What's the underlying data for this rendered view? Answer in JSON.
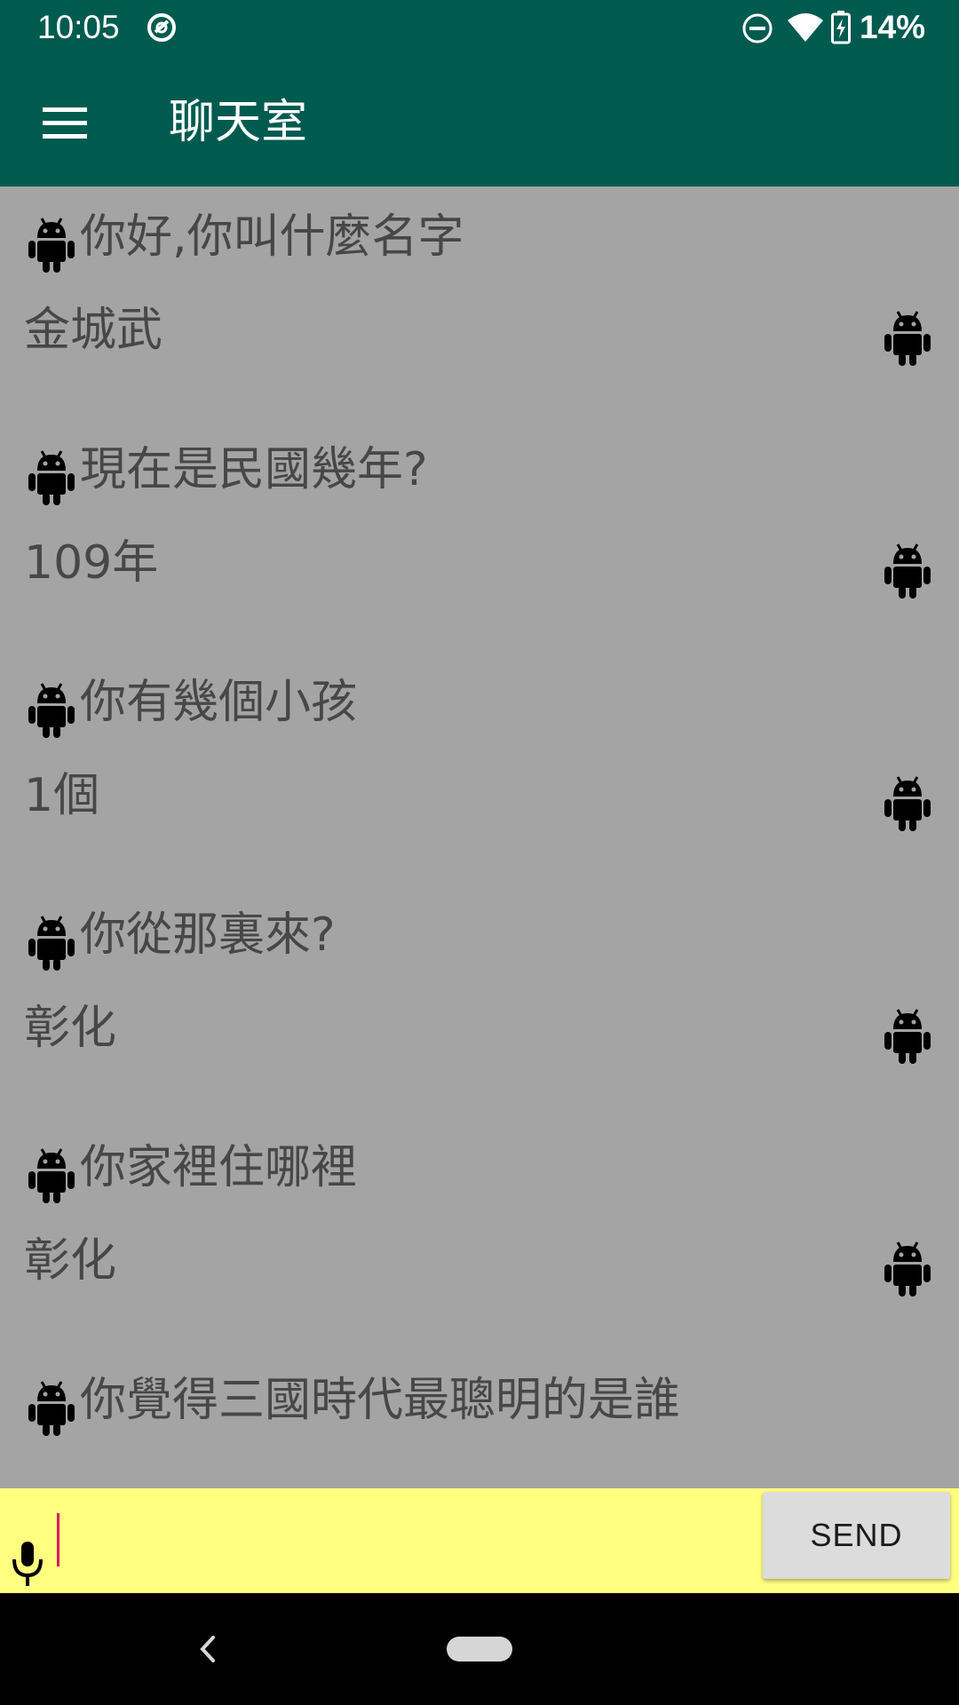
{
  "status_bar": {
    "time": "10:05",
    "battery_percent": "14%",
    "icons": [
      "sync-icon",
      "do-not-disturb-icon",
      "wifi-icon",
      "battery-charging-icon"
    ]
  },
  "app_bar": {
    "title": "聊天室",
    "menu_icon": "hamburger-menu-icon"
  },
  "messages": [
    {
      "question": "你好,你叫什麼名字",
      "answer": "金城武"
    },
    {
      "question": "現在是民國幾年?",
      "answer": "109年"
    },
    {
      "question": "你有幾個小孩",
      "answer": "1個"
    },
    {
      "question": "你從那裏來?",
      "answer": "彰化"
    },
    {
      "question": "你家裡住哪裡",
      "answer": "彰化"
    },
    {
      "question": "你覺得三國時代最聰明的是誰",
      "answer": ""
    }
  ],
  "input_bar": {
    "value": "",
    "send_label": "SEND",
    "mic_icon": "microphone-icon"
  },
  "nav_bar": {
    "icons": [
      "back-icon",
      "home-pill-icon"
    ]
  },
  "colors": {
    "primary": "#005b4f",
    "chat_background": "#a4a4a4",
    "input_background": "#ffff80",
    "text": "#474747",
    "caret": "#d81b60"
  }
}
